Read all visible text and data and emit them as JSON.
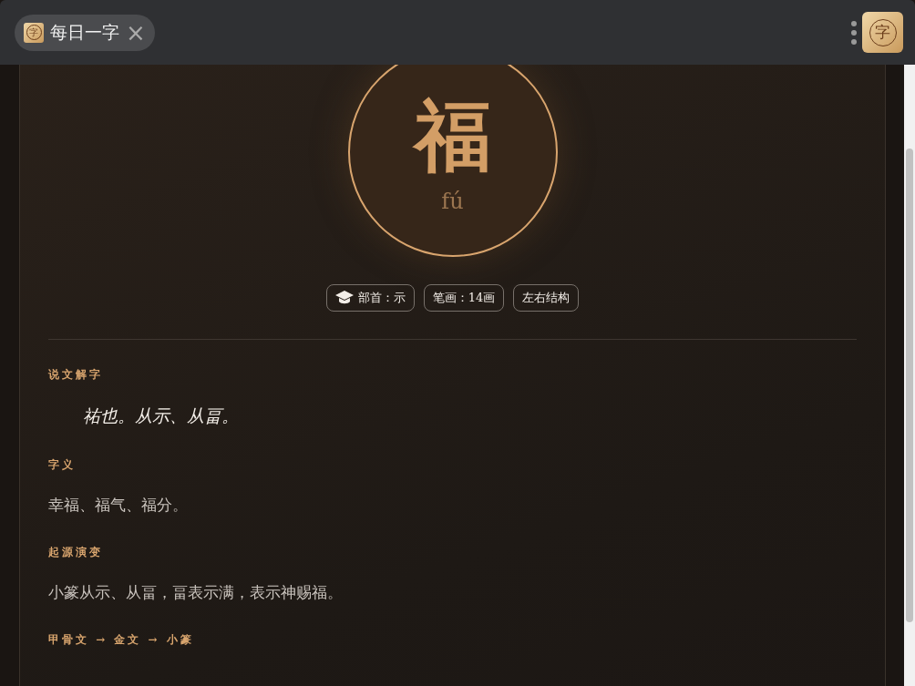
{
  "tab": {
    "logo_char": "字",
    "title": "每日一字",
    "close": "×"
  },
  "app_button": {
    "logo_char": "字"
  },
  "character": {
    "glyph": "福",
    "pinyin": "fú"
  },
  "tags": [
    {
      "kind": "radical",
      "text": "部首：示"
    },
    {
      "kind": "plain",
      "text": "笔画：14画"
    },
    {
      "kind": "plain",
      "text": "左右结构"
    }
  ],
  "sections": [
    {
      "kind": "quote",
      "heading": "说文解字",
      "body": "祐也。从示、从畐。"
    },
    {
      "kind": "text",
      "heading": "字义",
      "body": "幸福、福气、福分。"
    },
    {
      "kind": "text",
      "heading": "起源演变",
      "body": "小篆从示、从畐，畐表示满，表示神赐福。"
    },
    {
      "kind": "heading_only",
      "heading": "甲骨文 → 金文 → 小篆"
    }
  ]
}
